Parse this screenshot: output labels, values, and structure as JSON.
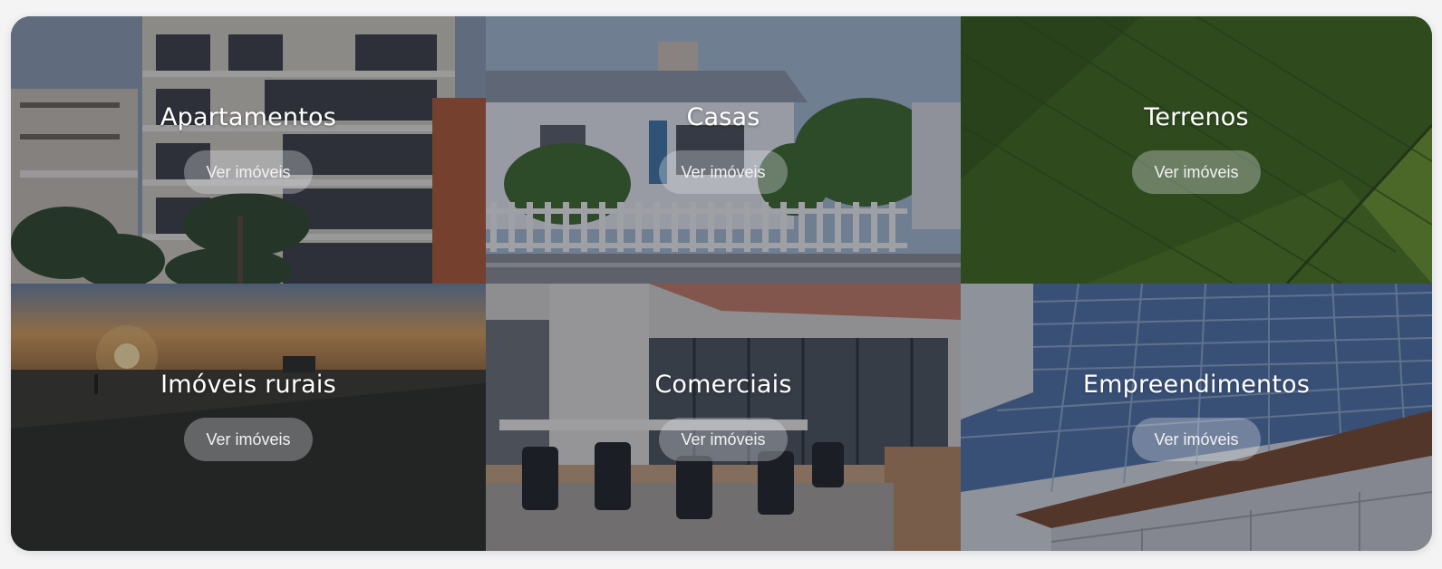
{
  "categories": [
    {
      "title": "Apartamentos",
      "button": "Ver imóveis"
    },
    {
      "title": "Casas",
      "button": "Ver imóveis"
    },
    {
      "title": "Terrenos",
      "button": "Ver imóveis"
    },
    {
      "title": "Imóveis rurais",
      "button": "Ver imóveis"
    },
    {
      "title": "Comerciais",
      "button": "Ver imóveis"
    },
    {
      "title": "Empreendimentos",
      "button": "Ver imóveis"
    }
  ],
  "colors": {
    "overlay": "#141826",
    "button_bg": "#e1e4eb",
    "text": "#ffffff",
    "page_bg": "#f4f4f5"
  }
}
